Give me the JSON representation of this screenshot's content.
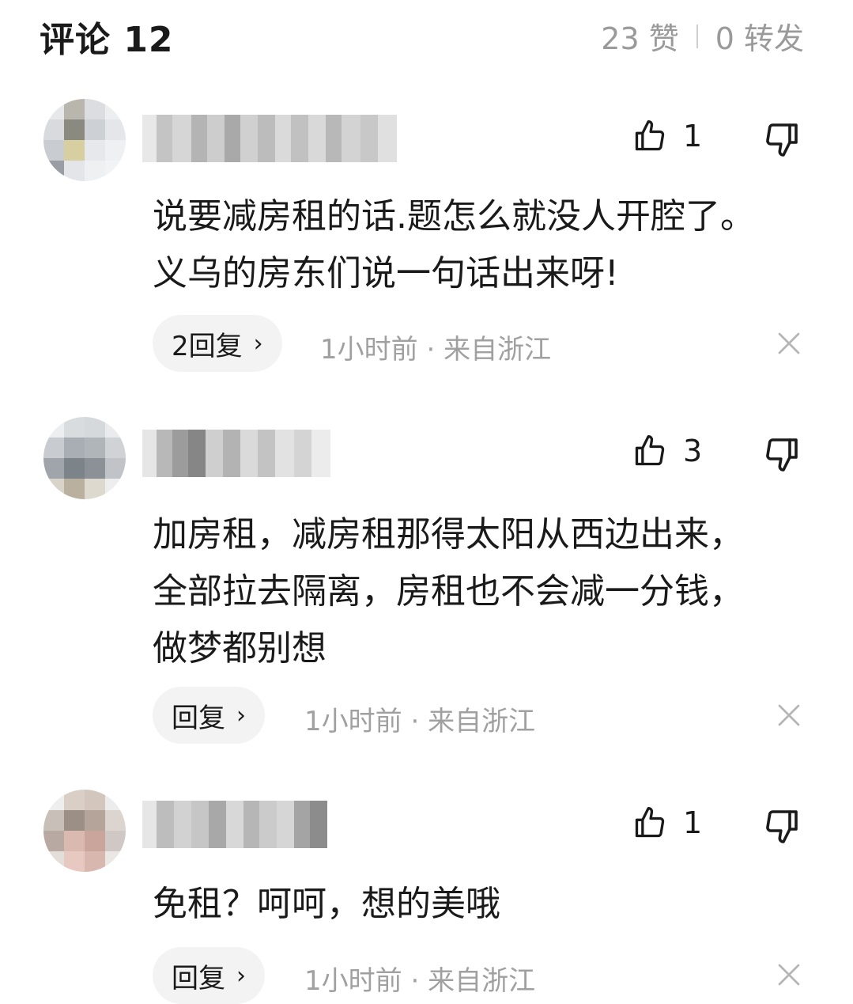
{
  "header": {
    "title": "评论 12",
    "likes": "23 赞",
    "shares": "0 转发"
  },
  "comments": [
    {
      "likes": "1",
      "text": "说要减房租的话.题怎么就没人开腔了。\n义乌的房东们说一句话出来呀!",
      "reply_label": "2回复",
      "time": "1小时前",
      "location": "来自浙江"
    },
    {
      "likes": "3",
      "text": "加房租，减房租那得太阳从西边出来，\n全部拉去隔离，房租也不会减一分钱，\n做梦都别想",
      "reply_label": "回复",
      "time": "1小时前",
      "location": "来自浙江"
    },
    {
      "likes": "1",
      "text": "免租？呵呵，想的美哦",
      "reply_label": "回复",
      "time": "1小时前",
      "location": "来自浙江"
    }
  ],
  "icons": {
    "like": "thumbs-up-icon",
    "dislike": "thumbs-down-icon",
    "close": "close-icon",
    "chevron": "chevron-right-icon"
  },
  "colors": {
    "text_primary": "#1a1a1a",
    "text_secondary": "#a0a0a0",
    "reply_bg": "#f3f3f3"
  }
}
